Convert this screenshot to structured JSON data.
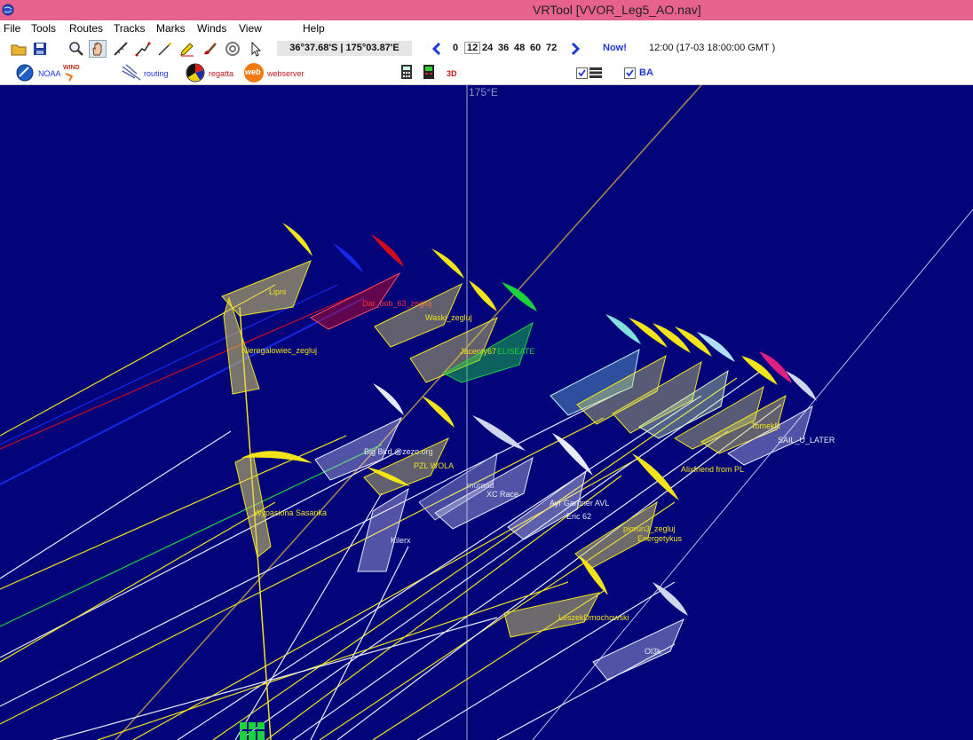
{
  "window": {
    "title": "VRTool [VVOR_Leg5_AO.nav]"
  },
  "menu": [
    "File",
    "Tools",
    "Routes",
    "Tracks",
    "Marks",
    "Winds",
    "View",
    "Help"
  ],
  "toolbar": {
    "coords": "36°37.68'S | 175°03.87'E",
    "time_steps": [
      "0",
      "12",
      "24",
      "36",
      "48",
      "60",
      "72"
    ],
    "selected_step": "12",
    "now_label": "Now!",
    "time_text": "12:00 (17-03 18:00:00 GMT )"
  },
  "toolbar2": {
    "noaa_label": "NOAA",
    "wind_label": "WIND",
    "routing_label": "routing",
    "regatta_label": "regatta",
    "web_icon_text": "web",
    "webserver_label": "webserver",
    "view3d_label": "3D",
    "ba_label": "BA",
    "checkbox1_checked": true,
    "checkbox_ba_checked": true
  },
  "map": {
    "longitude_label": "175°E",
    "colors": {
      "sea": "#03037a",
      "yellow": "#f2e419",
      "white": "#e8ecf8",
      "red": "#d10c18",
      "blue": "#1428ee",
      "green": "#1ad43c",
      "grey": "#8c8c8c",
      "brown": "#a9884a"
    },
    "boats": [
      {
        "name": "Lipni",
        "color": "yellow"
      },
      {
        "name": "Dar_bob_63_zegluj",
        "color": "red"
      },
      {
        "name": "Waski_zegluj",
        "color": "yellow"
      },
      {
        "name": "Nieregalowiec_zegluj",
        "color": "yellow"
      },
      {
        "name": "Jacenty67",
        "color": "yellow"
      },
      {
        "name": "ELISEATE",
        "color": "green"
      },
      {
        "name": "Big Bird @zezo.org",
        "color": "white"
      },
      {
        "name": "PZL WOLA",
        "color": "yellow"
      },
      {
        "name": "Wypasiona Sasanka",
        "color": "yellow"
      },
      {
        "name": "muroad",
        "color": "grey"
      },
      {
        "name": "XC Race",
        "color": "white"
      },
      {
        "name": "Ayr Gardner AVL",
        "color": "white"
      },
      {
        "name": "Eric 62",
        "color": "white"
      },
      {
        "name": "Alixfriend from PL",
        "color": "yellow"
      },
      {
        "name": "SAIL_U_LATER",
        "color": "white"
      },
      {
        "name": "TomekN",
        "color": "yellow"
      },
      {
        "name": "Kilerx",
        "color": "white"
      },
      {
        "name": "piorun3_zegluj",
        "color": "yellow"
      },
      {
        "name": "Energetykus",
        "color": "yellow"
      },
      {
        "name": "LeszekDmochowski",
        "color": "yellow"
      },
      {
        "name": "Ol3k",
        "color": "white"
      }
    ]
  }
}
